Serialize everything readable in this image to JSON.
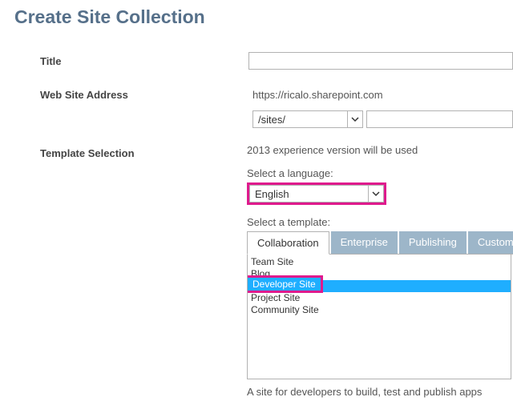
{
  "page_title": "Create Site Collection",
  "labels": {
    "title": "Title",
    "web_site_address": "Web Site Address",
    "template_selection": "Template Selection"
  },
  "title_field": {
    "value": ""
  },
  "address": {
    "base_url": "https://ricalo.sharepoint.com",
    "path_select": "/sites/",
    "suffix_value": ""
  },
  "template": {
    "experience_note": "2013 experience version will be used",
    "language_label": "Select a language:",
    "language_value": "English",
    "template_label": "Select a template:",
    "tabs": {
      "collaboration": "Collaboration",
      "enterprise": "Enterprise",
      "publishing": "Publishing",
      "custom": "Custom"
    },
    "options": {
      "team_site": "Team Site",
      "blog": "Blog",
      "developer_site": "Developer Site",
      "project_site": "Project Site",
      "community_site": "Community Site"
    },
    "description": "A site for developers to build, test and publish apps"
  }
}
